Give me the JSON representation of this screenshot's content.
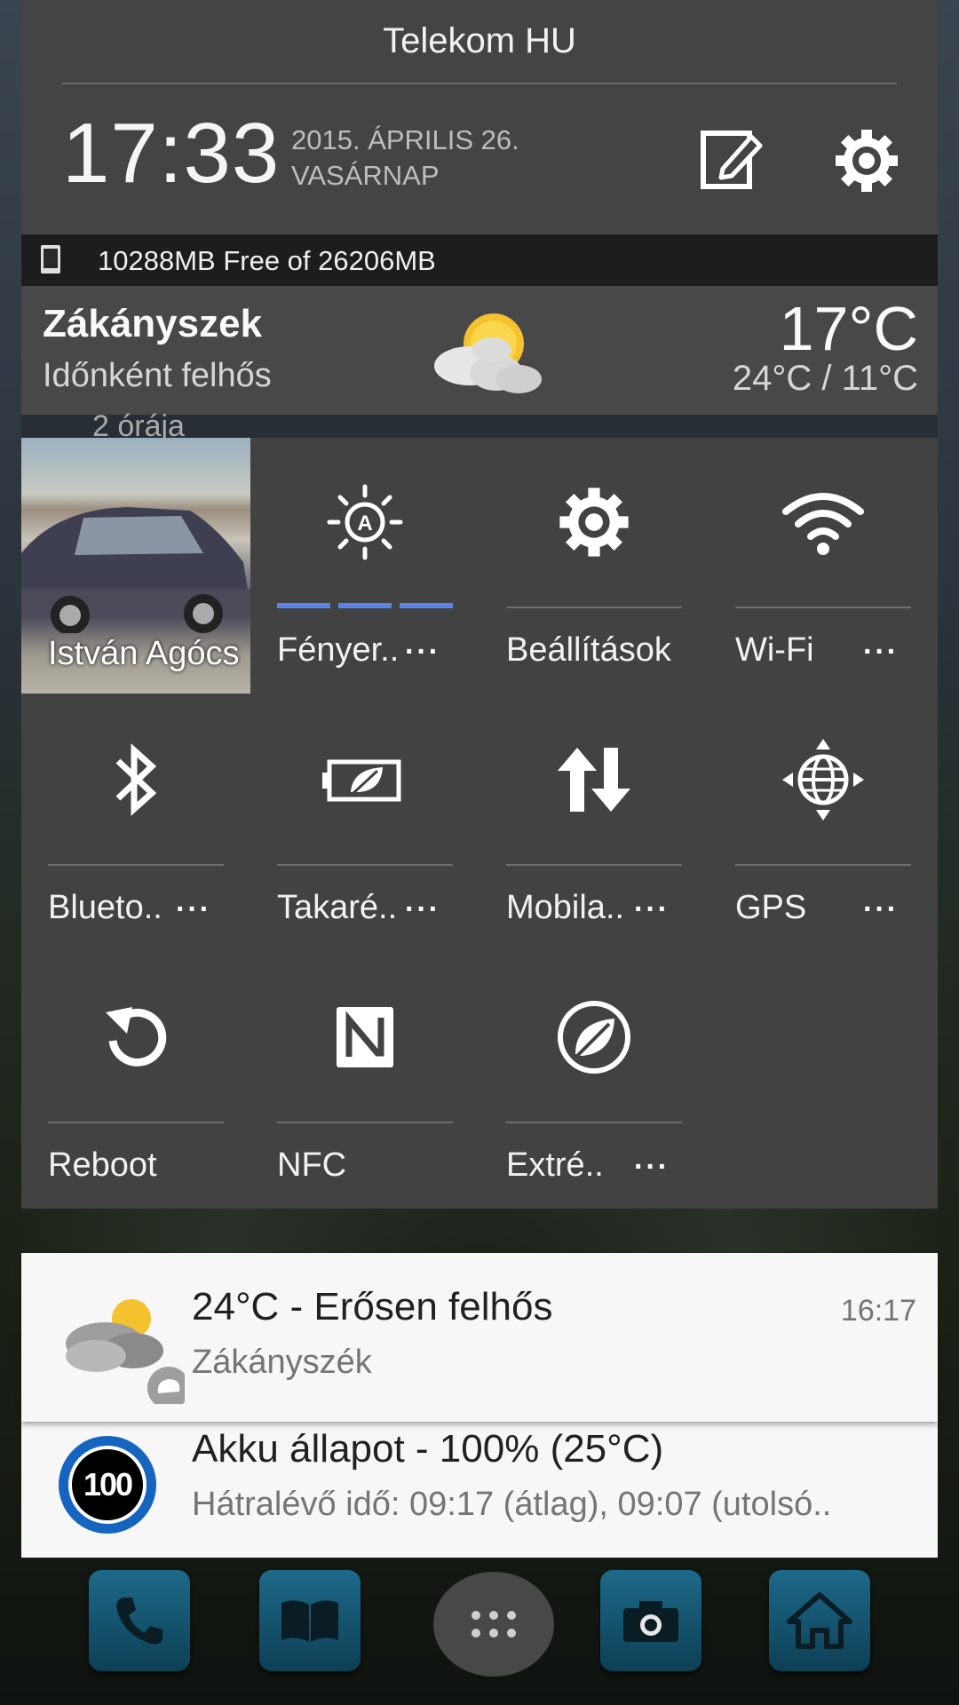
{
  "status": {
    "carrier": "Telekom HU"
  },
  "header": {
    "time": "17:33",
    "date_line1": "2015. ÁPRILIS 26.",
    "date_line2": "VASÁRNAP"
  },
  "storage": {
    "text": "10288MB Free of 26206MB"
  },
  "weather": {
    "city": "Zákányszek",
    "description": "Időnként felhős",
    "temp": "17°C",
    "range": "24°C / 11°C",
    "updated": "2 órája",
    "icon": "partly-cloudy-icon"
  },
  "quick_settings": {
    "contact": {
      "name": "István Agócs"
    },
    "tiles": [
      {
        "label": "Fényer..",
        "icon": "auto-brightness-icon",
        "more": "···"
      },
      {
        "label": "Beállítások",
        "icon": "gear-icon"
      },
      {
        "label": "Wi-Fi",
        "icon": "wifi-icon",
        "more": "···"
      },
      {
        "label": "Blueto..",
        "icon": "bluetooth-icon",
        "more": "···"
      },
      {
        "label": "Takaré..",
        "icon": "power-saver-icon",
        "more": "···"
      },
      {
        "label": "Mobila..",
        "icon": "mobile-data-icon",
        "more": "···"
      },
      {
        "label": "GPS",
        "icon": "gps-icon",
        "more": "···"
      },
      {
        "label": "Reboot",
        "icon": "reboot-icon"
      },
      {
        "label": "NFC",
        "icon": "nfc-icon"
      },
      {
        "label": "Extré..",
        "icon": "extreme-power-saver-icon",
        "more": "···"
      }
    ],
    "accent": "#5a84e6"
  },
  "notifications": [
    {
      "title": "24°C - Erősen felhős",
      "subtitle": "Zákányszék",
      "time": "16:17"
    },
    {
      "title": "Akku állapot - 100% (25°C)",
      "subtitle": "Hátralévő idő: 09:17 (átlag), 09:07 (utolsó..",
      "badge": "100"
    }
  ],
  "dock": [
    "phone-icon",
    "book-icon",
    "app-drawer-icon",
    "camera-icon",
    "home-icon"
  ]
}
